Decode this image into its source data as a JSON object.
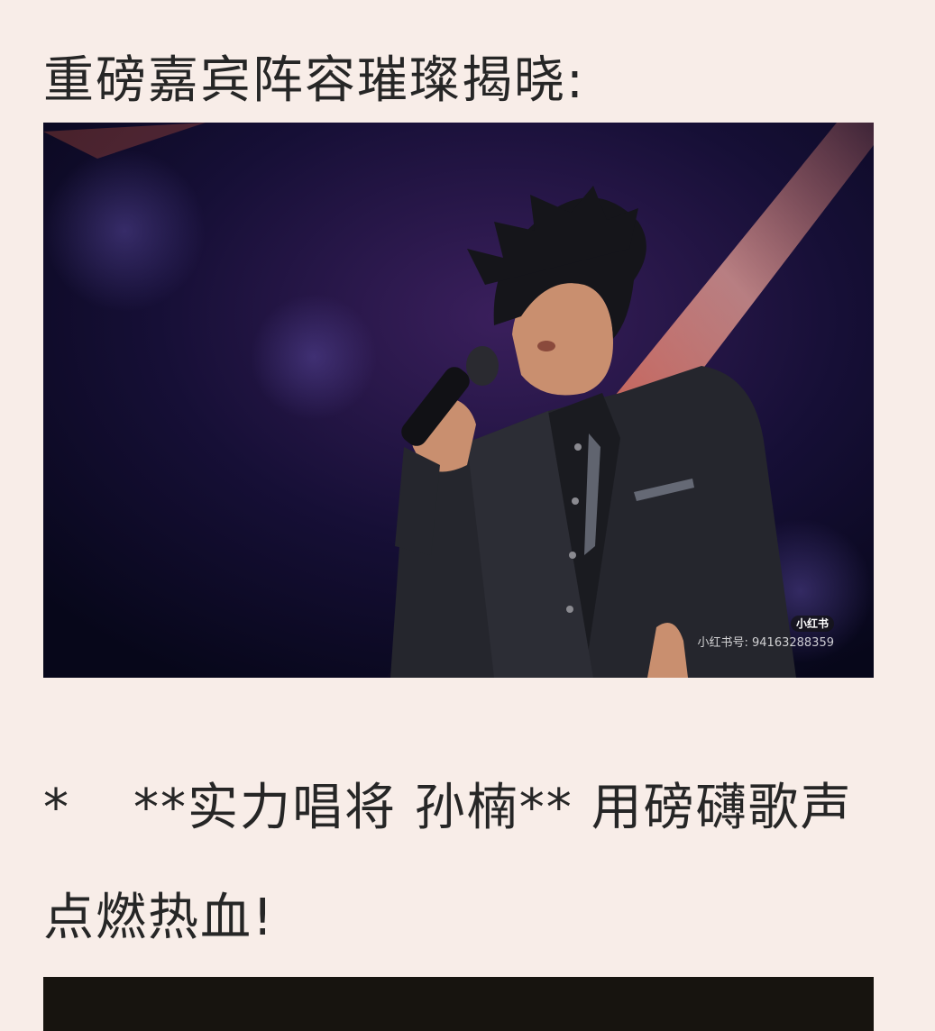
{
  "article": {
    "heading": "重磅嘉宾阵容璀璨揭晓:",
    "photo1": {
      "watermark_badge": "小红书",
      "watermark_id": "小红书号: 94163288359"
    },
    "bullet": "*",
    "paragraph": "**实力唱将 孙楠** 用磅礴歌声点燃热血!"
  }
}
